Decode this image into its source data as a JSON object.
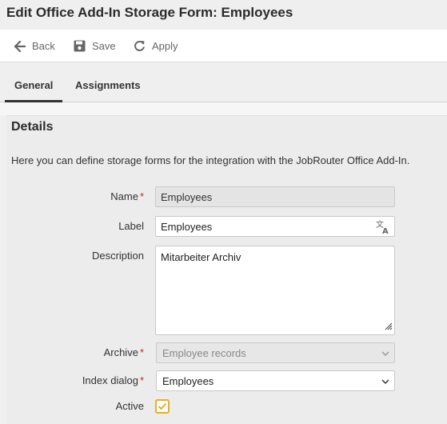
{
  "page_title": "Edit Office Add-In Storage Form: Employees",
  "toolbar": {
    "back_label": "Back",
    "save_label": "Save",
    "apply_label": "Apply"
  },
  "tabs": [
    {
      "label": "General",
      "active": true
    },
    {
      "label": "Assignments",
      "active": false
    }
  ],
  "details": {
    "heading": "Details",
    "intro": "Here you can define storage forms for the integration with the JobRouter Office Add-In."
  },
  "form": {
    "name": {
      "label": "Name",
      "value": "Employees",
      "required": true
    },
    "label": {
      "label": "Label",
      "value": "Employees"
    },
    "description": {
      "label": "Description",
      "value": "Mitarbeiter Archiv"
    },
    "archive": {
      "label": "Archive",
      "value": "Employee records",
      "required": true
    },
    "index_dialog": {
      "label": "Index dialog",
      "value": "Employees",
      "required": true
    },
    "active": {
      "label": "Active",
      "checked": true
    }
  },
  "colors": {
    "accent": "#e8b020",
    "required": "#d0212b"
  },
  "icons": [
    "arrow-left-icon",
    "floppy-disk-icon",
    "refresh-icon",
    "translate-icon",
    "chevron-down-icon",
    "resize-grip-icon",
    "checkmark-icon"
  ]
}
